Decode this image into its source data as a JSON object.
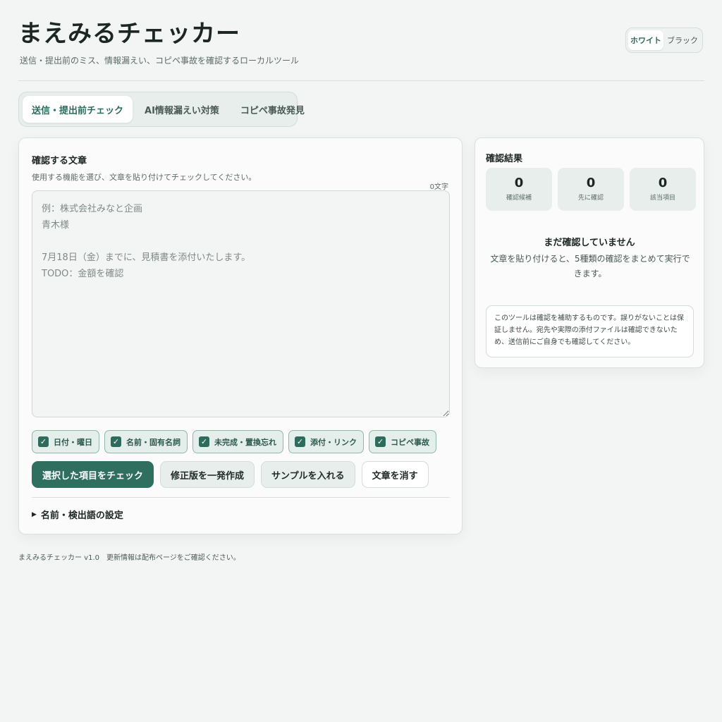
{
  "header": {
    "title": "まえみるチェッカー",
    "subtitle": "送信・提出前のミス、情報漏えい、コピペ事故を確認するローカルツール"
  },
  "theme": {
    "options": [
      "ホワイト",
      "ブラック"
    ],
    "selected": "ホワイト"
  },
  "tabs": [
    {
      "label": "送信・提出前チェック",
      "active": true
    },
    {
      "label": "AI情報漏えい対策",
      "active": false
    },
    {
      "label": "コピペ事故発見",
      "active": false
    }
  ],
  "input_panel": {
    "title": "確認する文章",
    "description": "使用する機能を選び、文章を貼り付けてチェックしてください。",
    "char_count": "0文字",
    "placeholder": "例：株式会社みなと企画\n青木様\n\n7月18日（金）までに、見積書を添付いたします。\nTODO：金額を確認",
    "value": "",
    "checks": [
      {
        "label": "日付・曜日",
        "checked": true
      },
      {
        "label": "名前・固有名詞",
        "checked": true
      },
      {
        "label": "未完成・置換忘れ",
        "checked": true
      },
      {
        "label": "添付・リンク",
        "checked": true
      },
      {
        "label": "コピペ事故",
        "checked": true
      }
    ],
    "actions": {
      "check": "選択した項目をチェック",
      "revise": "修正版を一発作成",
      "sample": "サンプルを入れる",
      "clear": "文章を消す"
    },
    "settings_label": "名前・検出語の設定"
  },
  "result_panel": {
    "title": "確認結果",
    "stats": [
      {
        "value": "0",
        "label": "確認候補"
      },
      {
        "value": "0",
        "label": "先に確認"
      },
      {
        "value": "0",
        "label": "該当項目"
      }
    ],
    "empty_title": "まだ確認していません",
    "empty_desc": "文章を貼り付けると、5種類の確認をまとめて実行できます。",
    "notice": "このツールは確認を補助するものです。誤りがないことは保証しません。宛先や実際の添付ファイルは確認できないため、送信前にご自身でも確認してください。"
  },
  "footer": {
    "text": "まえみるチェッカー v1.0　更新情報は配布ページをご確認ください。"
  },
  "colors": {
    "accent": "#2f6f60",
    "background": "#f3f5f4"
  }
}
